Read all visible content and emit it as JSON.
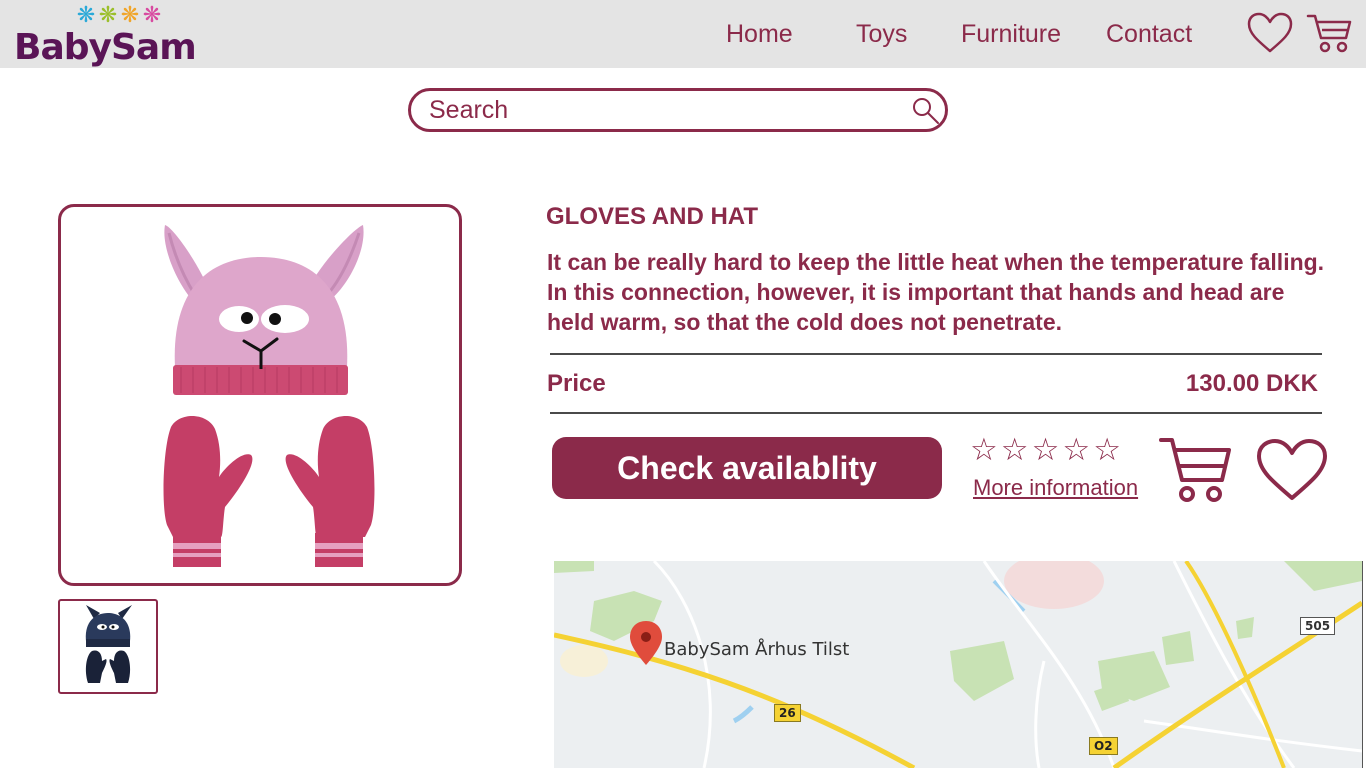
{
  "header": {
    "logo_text": "BabySam",
    "logo_flowers": [
      "❋",
      "❋",
      "❋",
      "❋"
    ],
    "logo_flower_colors": [
      "#2aa9d8",
      "#9bbf2a",
      "#f0a52a",
      "#d84aa0"
    ],
    "nav": [
      {
        "label": "Home"
      },
      {
        "label": "Toys"
      },
      {
        "label": "Furniture"
      },
      {
        "label": "Contact"
      }
    ],
    "icons": [
      "heart-icon",
      "cart-icon"
    ]
  },
  "search": {
    "placeholder": "Search",
    "value": "",
    "icon": "search-icon"
  },
  "product": {
    "title": "GLOVES AND HAT",
    "description": "It can be really hard to keep the little heat when the temperature falling. In this connection, however, it is important that hands and head are held warm, so that the cold does not penetrate.",
    "price_label": "Price",
    "price_value": "130.00 DKK",
    "check_button": "Check availablity",
    "rating": {
      "max": 5,
      "value": 0,
      "star_glyph": "☆"
    },
    "more_info": "More information",
    "icons": [
      "cart-icon",
      "heart-icon"
    ],
    "images": {
      "main": {
        "name": "pink-hat-and-mittens",
        "color": "#d8a0c8"
      },
      "thumbnails": [
        {
          "name": "navy-hat-and-mittens",
          "color": "#1f2a44"
        }
      ]
    }
  },
  "map": {
    "location_label": "BabySam Århus Tilst",
    "road_signs": [
      "26",
      "O2",
      "505"
    ],
    "pin_icon": "map-pin-icon"
  },
  "colors": {
    "accent": "#8b2a4a",
    "header_bg": "#e4e4e4",
    "logo_text": "#5a1456"
  }
}
